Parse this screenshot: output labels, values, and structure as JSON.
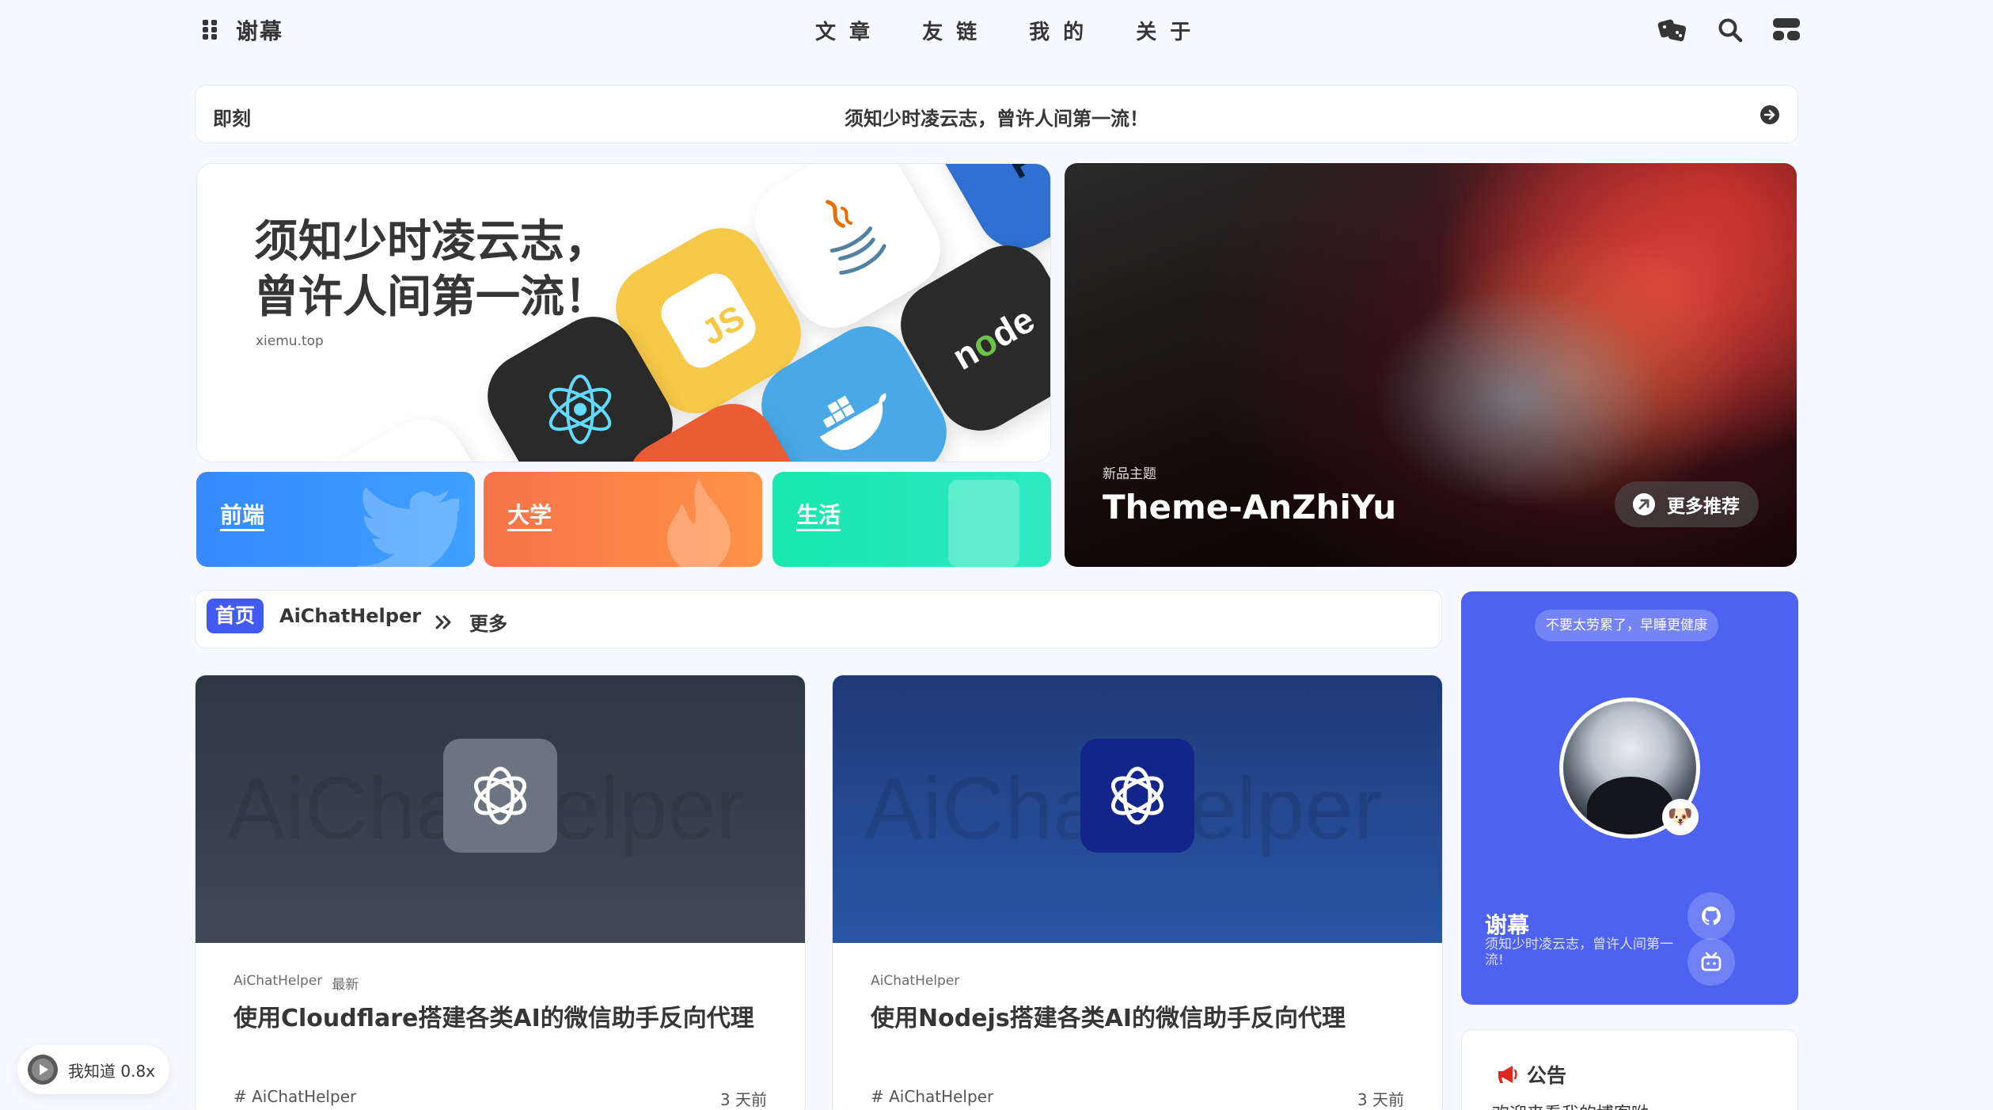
{
  "nav": {
    "site_name": "谢幕",
    "menu": [
      "文 章",
      "友 链",
      "我 的",
      "关 于"
    ]
  },
  "moment": {
    "title": "即刻",
    "text": "须知少时凌云志，曾许人间第一流！"
  },
  "hero": {
    "title": "须知少时凌云志，\n曾许人间第一流！",
    "url": "xiemu.top"
  },
  "categories": [
    {
      "label": "前端",
      "color": "#358bff"
    },
    {
      "label": "大学",
      "color": "#f7734a"
    },
    {
      "label": "生活",
      "color": "#18e7ae"
    }
  ],
  "feature": {
    "subtitle": "新品主题",
    "title": "Theme-AnZhiYu",
    "button": "更多推荐"
  },
  "tabs": {
    "home": "首页",
    "current": "AiChatHelper",
    "more": "更多"
  },
  "posts": [
    {
      "category": "AiChatHelper",
      "badge": "最新",
      "title": "使用Cloudflare搭建各类AI的微信助手反向代理",
      "tag": "# AiChatHelper",
      "time": "3 天前",
      "watermark": "AiChatHelper"
    },
    {
      "category": "AiChatHelper",
      "badge": "",
      "title": "使用Nodejs搭建各类AI的微信助手反向代理",
      "tag": "# AiChatHelper",
      "time": "3 天前",
      "watermark": "AiChatHelper"
    }
  ],
  "author": {
    "tip": "不要太劳累了，早睡更健康",
    "name": "谢幕",
    "description": "须知少时凌云志，曾许人间第一流!"
  },
  "notice": {
    "title": "公告",
    "text": "欢迎来看我的博客呦"
  },
  "player": {
    "text": "我知道 0.8x"
  }
}
